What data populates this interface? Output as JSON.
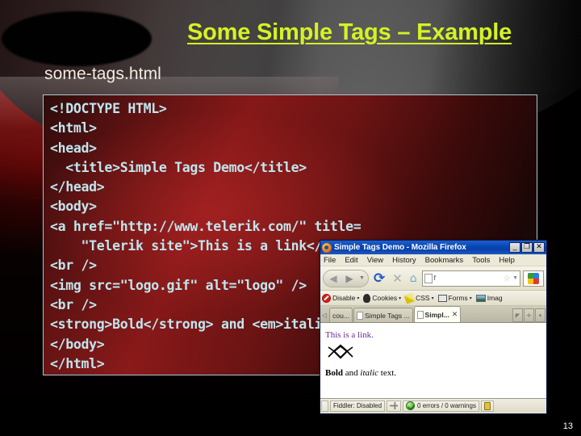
{
  "slide": {
    "title": "Some Simple Tags – Example",
    "subtitle": "some-tags.html",
    "page_number": "13",
    "accent_title_color": "#d5f224",
    "code_text_color": "#bfe6ee",
    "code_bg_color": "#8d1a1a",
    "background_color": "#000000"
  },
  "code": {
    "language": "html",
    "text": "<!DOCTYPE HTML>\n<html>\n<head>\n  <title>Simple Tags Demo</title>\n</head>\n<body>\n<a href=\"http://www.telerik.com/\" title=\n    \"Telerik site\">This is a link</a>\n<br />\n<img src=\"logo.gif\" alt=\"logo\" />\n<br />\n<strong>Bold</strong> and <em>italic</em> text.\n</body>\n</html>"
  },
  "browser": {
    "titlebar": {
      "logo_icon": "firefox-icon",
      "title": "Simple Tags Demo - Mozilla Firefox",
      "minimize_label": "_",
      "maximize_label": "❐",
      "close_label": "✕"
    },
    "menubar": [
      "File",
      "Edit",
      "View",
      "History",
      "Bookmarks",
      "Tools",
      "Help"
    ],
    "navbar": {
      "back_icon": "back-arrow-icon",
      "forward_icon": "forward-arrow-icon",
      "dropdown_icon": "chevron-down-icon",
      "reload_icon": "reload-icon",
      "stop_icon": "stop-icon",
      "home_icon": "home-icon",
      "url_value": "f",
      "url_placeholder": "",
      "star_icon": "star-icon",
      "search_icon": "google-search-icon"
    },
    "devtoolbar": [
      {
        "icon": "disable-icon",
        "label": "Disable"
      },
      {
        "icon": "cookie-icon",
        "label": "Cookies"
      },
      {
        "icon": "css-icon",
        "label": "CSS"
      },
      {
        "icon": "forms-icon",
        "label": "Forms"
      },
      {
        "icon": "images-icon",
        "label": "Imag"
      }
    ],
    "tabs": {
      "scroll_left_icon": "scroll-left-icon",
      "items": [
        {
          "label": "cou...",
          "active": false,
          "closable": false
        },
        {
          "label": "Simple Tags ...",
          "active": false,
          "closable": false
        },
        {
          "label": "Simpl...",
          "active": true,
          "closable": true
        }
      ],
      "close_label": "✕",
      "list_all_icon": "tab-list-icon",
      "new_tab_icon": "new-tab-icon",
      "menu_icon": "tab-menu-icon"
    },
    "content": {
      "link_text": "This is a link.",
      "broken_image_icon": "broken-image-icon",
      "bold_text": "Bold",
      "middle_text": " and ",
      "italic_text": "italic",
      "tail_text": " text."
    },
    "statusbar": {
      "fiddler_label": "Fiddler: Disabled",
      "plugin_icon": "plugin-icon",
      "errors_icon": "ok-circle-icon",
      "errors_label": "0 errors / 0 warnings",
      "lock_icon": "lock-icon"
    }
  }
}
